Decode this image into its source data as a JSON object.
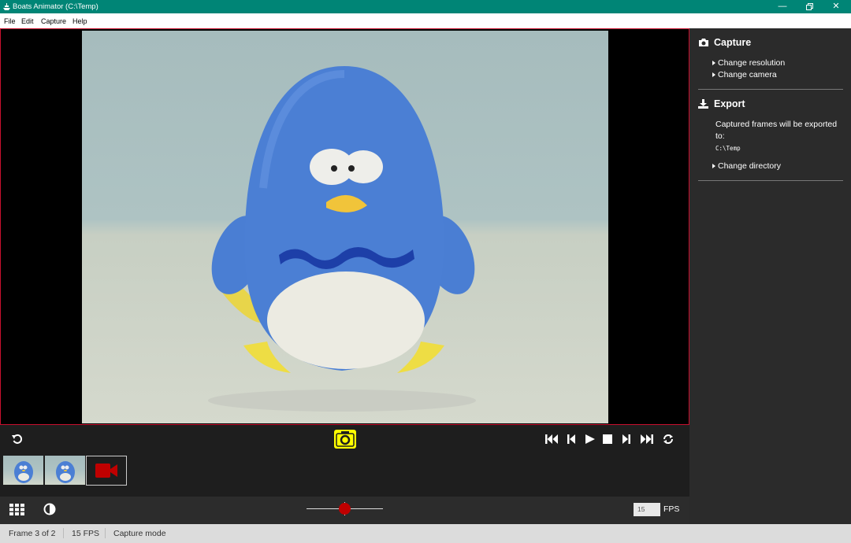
{
  "window": {
    "title": "Boats Animator (C:\\Temp)"
  },
  "menu": {
    "file": "File",
    "edit": "Edit",
    "capture": "Capture",
    "help": "Help"
  },
  "sidebar": {
    "capture_heading": "Capture",
    "change_resolution": "Change resolution",
    "change_camera": "Change camera",
    "export_heading": "Export",
    "export_text": "Captured frames will be exported to:",
    "export_path": "C:\\Temp",
    "change_directory": "Change directory"
  },
  "playback": {
    "fps_value": "15",
    "fps_label": "FPS"
  },
  "status": {
    "frame": "Frame 3 of 2",
    "fps": "15 FPS",
    "mode": "Capture mode"
  },
  "colors": {
    "titlebar": "#008576",
    "accent_yellow": "#ffff00",
    "record_red": "#c00000",
    "onion_slider": "#c00000"
  }
}
